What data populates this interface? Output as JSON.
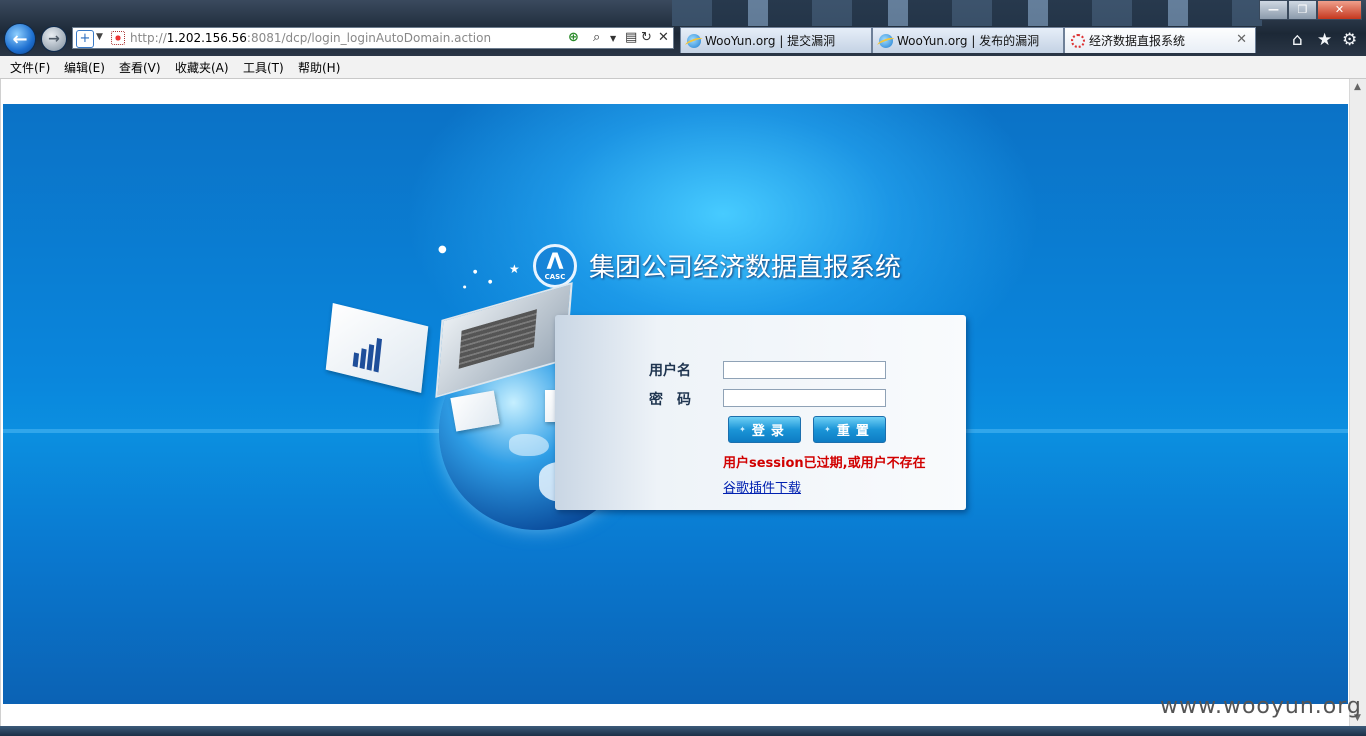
{
  "browser": {
    "url_prefix": "http://",
    "url_host": "1.202.156.56",
    "url_rest": ":8081/dcp/login_loginAutoDomain.action",
    "tabs": [
      {
        "label": "WooYun.org | 提交漏洞"
      },
      {
        "label": "WooYun.org | 发布的漏洞"
      },
      {
        "label": "经济数据直报系统"
      }
    ],
    "menu": [
      "文件(F)",
      "编辑(E)",
      "查看(V)",
      "收藏夹(A)",
      "工具(T)",
      "帮助(H)"
    ]
  },
  "page": {
    "system_title": "集团公司经济数据直报系统",
    "logo_text": "CASC",
    "username_label": "用户名",
    "password_label": "密　码",
    "login_button": "登录",
    "reset_button": "重置",
    "error_message": "用户session已过期,或用户不存在",
    "download_link": "谷歌插件下载"
  },
  "watermark": "www.wooyun.org",
  "colors": {
    "accent_blue": "#0a86dc",
    "error_red": "#d10000",
    "link_blue": "#0020b0"
  }
}
